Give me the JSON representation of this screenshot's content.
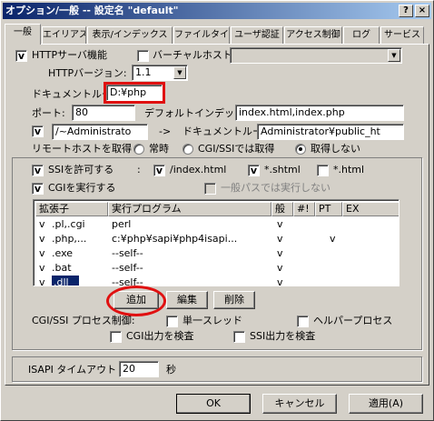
{
  "window": {
    "title": "オプション/一般 -- 設定名 \"default\"",
    "help_glyph": "?",
    "close_glyph": "×"
  },
  "tabs": [
    "一般",
    "エイリアス",
    "表示/インデックス",
    "ファイルタイプ",
    "ユーザ認証",
    "アクセス制御",
    "ログ",
    "サービス"
  ],
  "http": {
    "server_label": "HTTPサーバ機能",
    "virtual_label": "バーチャルホスト",
    "version_label": "HTTPバージョン:",
    "version_value": "1.1"
  },
  "doc": {
    "root_label": "ドキュメントルート:",
    "root_value": "D:¥php",
    "port_label": "ポート:",
    "port_value": "80",
    "index_label": "デフォルトインデックス:",
    "index_value": "index.html,index.php"
  },
  "alias": {
    "from_value": "/~Administrato",
    "arrow": "->",
    "root_label": "ドキュメントルート¥",
    "path_value": "Administrator¥public_ht"
  },
  "remote": {
    "label": "リモートホストを取得",
    "opt_always": "常時",
    "opt_cgi": "CGI/SSIでは取得",
    "opt_none": "取得しない"
  },
  "ssi": {
    "allow_label": "SSIを許可する",
    "colon": ":",
    "index_html": "/index.html",
    "shtml": "*.shtml",
    "html": "*.html"
  },
  "cgi": {
    "exec_label": "CGIを実行する",
    "general_path_label": "一般パスでは実行しない"
  },
  "list": {
    "headers": [
      "拡張子",
      "実行プログラム",
      "般",
      "#!",
      "PT",
      "EX"
    ],
    "rows": [
      {
        "ext": ".pl,.cgi",
        "prog": "perl",
        "gen": "v",
        "hash": "",
        "pt": "",
        "ex": ""
      },
      {
        "ext": ".php,...",
        "prog": "c:¥php¥sapi¥php4isapi...",
        "gen": "v",
        "hash": "",
        "pt": "v",
        "ex": ""
      },
      {
        "ext": ".exe",
        "prog": "--self--",
        "gen": "v",
        "hash": "",
        "pt": "",
        "ex": ""
      },
      {
        "ext": ".bat",
        "prog": "--self--",
        "gen": "v",
        "hash": "",
        "pt": "",
        "ex": ""
      },
      {
        "ext": ".dll",
        "prog": "--self--",
        "gen": "v",
        "hash": "",
        "pt": "",
        "ex": ""
      }
    ],
    "check_mark": "v"
  },
  "buttons": {
    "add": "追加",
    "edit": "編集",
    "delete": "削除",
    "ok": "OK",
    "cancel": "キャンセル",
    "apply": "適用(A)"
  },
  "process": {
    "label": "CGI/SSI プロセス制御:",
    "single_thread": "単一スレッド",
    "helper": "ヘルパープロセス",
    "check_cgi_output": "CGI出力を検査",
    "check_ssi_output": "SSI出力を検査"
  },
  "isapi": {
    "timeout_label": "ISAPI タイムアウト",
    "timeout_value": "20",
    "unit": "秒"
  },
  "colors": {
    "title_start": "#0a246a",
    "title_end": "#a6caf0",
    "highlight": "#e01010",
    "selection": "#0a246a"
  }
}
